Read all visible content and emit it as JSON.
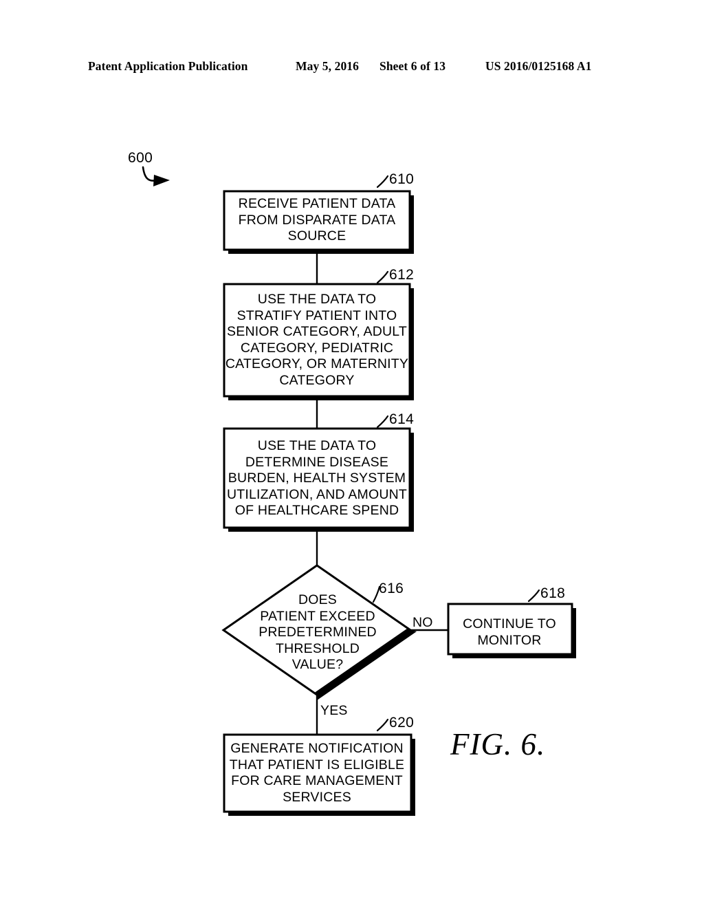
{
  "header": {
    "publication": "Patent Application Publication",
    "date": "May 5, 2016",
    "sheet": "Sheet 6 of 13",
    "patent_number": "US 2016/0125168 A1"
  },
  "figure": {
    "caption": "FIG. 6.",
    "diagram_ref": "600",
    "type": "flowchart",
    "nodes": [
      {
        "ref": "610",
        "shape": "process",
        "text": "RECEIVE PATIENT DATA\nFROM DISPARATE DATA\nSOURCE"
      },
      {
        "ref": "612",
        "shape": "process",
        "text": "USE THE DATA TO\nSTRATIFY PATIENT INTO\nSENIOR CATEGORY, ADULT\nCATEGORY, PEDIATRIC\nCATEGORY, OR MATERNITY\nCATEGORY"
      },
      {
        "ref": "614",
        "shape": "process",
        "text": "USE THE DATA TO\nDETERMINE DISEASE\nBURDEN, HEALTH SYSTEM\nUTILIZATION, AND AMOUNT\nOF HEALTHCARE SPEND"
      },
      {
        "ref": "616",
        "shape": "decision",
        "text": "DOES\nPATIENT EXCEED\nPREDETERMINED\nTHRESHOLD\nVALUE?"
      },
      {
        "ref": "618",
        "shape": "process",
        "text": "CONTINUE TO\nMONITOR"
      },
      {
        "ref": "620",
        "shape": "process",
        "text": "GENERATE NOTIFICATION\nTHAT PATIENT IS ELIGIBLE\nFOR CARE MANAGEMENT\nSERVICES"
      }
    ],
    "edges": [
      {
        "from": "610",
        "to": "612",
        "label": ""
      },
      {
        "from": "612",
        "to": "614",
        "label": ""
      },
      {
        "from": "614",
        "to": "616",
        "label": ""
      },
      {
        "from": "616",
        "to": "618",
        "label": "NO"
      },
      {
        "from": "616",
        "to": "620",
        "label": "YES"
      }
    ],
    "colors": {
      "line": "#000000",
      "fill": "#ffffff",
      "text": "#000000"
    }
  }
}
